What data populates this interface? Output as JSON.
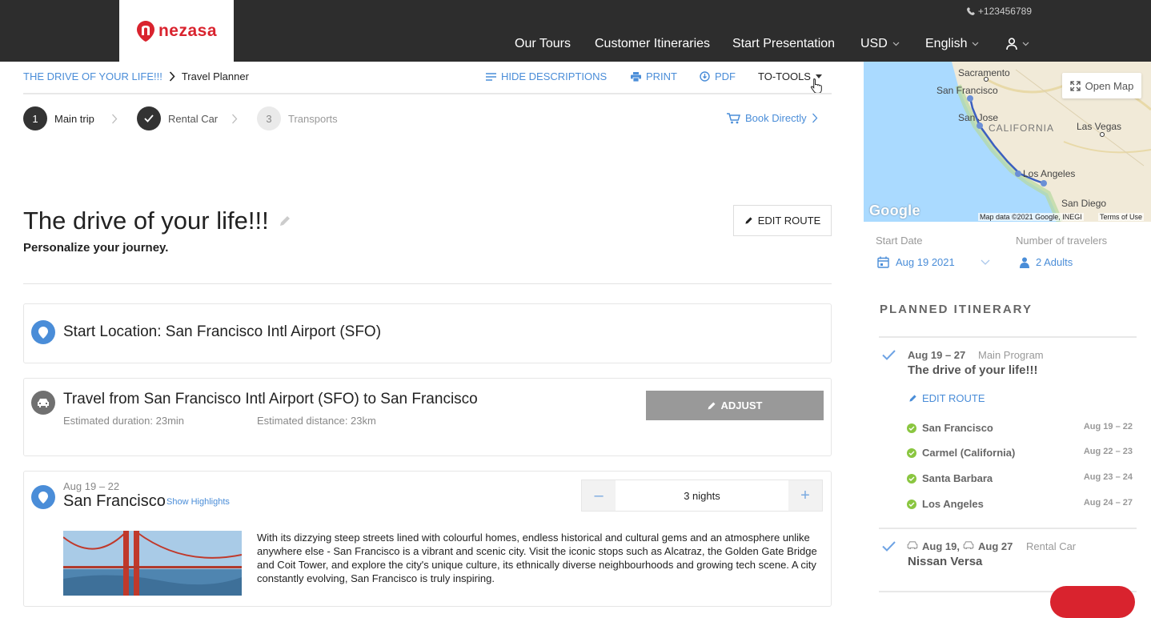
{
  "header": {
    "logo_text": "nezasa",
    "phone": "+123456789",
    "nav": {
      "our_tours": "Our Tours",
      "customer_itineraries": "Customer Itineraries",
      "start_presentation": "Start Presentation",
      "currency": "USD",
      "language": "English"
    }
  },
  "breadcrumb": {
    "root": "THE DRIVE OF YOUR LIFE!!!",
    "current": "Travel Planner"
  },
  "toolbar": {
    "hide_descriptions": "HIDE DESCRIPTIONS",
    "print": "PRINT",
    "pdf": "PDF",
    "to_tools": "TO-TOOLS"
  },
  "steps": [
    {
      "num": "1",
      "label": "Main trip"
    },
    {
      "num": "",
      "label": "Rental Car"
    },
    {
      "num": "3",
      "label": "Transports"
    }
  ],
  "book_directly": "Book Directly",
  "trip": {
    "title": "The drive of your life!!!",
    "subtitle": "Personalize your journey.",
    "edit_route": "EDIT ROUTE"
  },
  "start_card": {
    "title": "Start Location: San Francisco Intl Airport (SFO)"
  },
  "travel_card": {
    "title": "Travel from San Francisco Intl Airport (SFO) to San Francisco",
    "duration": "Estimated duration: 23min",
    "distance": "Estimated distance: 23km",
    "adjust": "ADJUST"
  },
  "stay_card": {
    "dates": "Aug 19 – 22",
    "city": "San Francisco",
    "highlights": "Show Highlights",
    "nights": "3 nights",
    "minus": "–",
    "plus": "+",
    "description": "With its dizzying steep streets lined with colourful homes, endless historical and cultural gems and an atmosphere unlike anywhere else - San Francisco is a vibrant and scenic city. Visit the iconic stops such as Alcatraz, the Golden Gate Bridge and Coit Tower, and explore the city's unique culture, its ethnically diverse neighbourhoods and growing tech scene. A city constantly evolving, San Francisco is truly inspiring."
  },
  "map": {
    "open_map": "Open Map",
    "labels": {
      "sacramento": "Sacramento",
      "san_francisco": "San Francisco",
      "san_jose": "San Jose",
      "california": "CALIFORNIA",
      "las_vegas": "Las Vegas",
      "los_angeles": "Los Angeles",
      "san_diego": "San Diego"
    },
    "google": "Google",
    "attribution": "Map data ©2021 Google, INEGI",
    "terms": "Terms of Use"
  },
  "sidebar": {
    "start_date_label": "Start Date",
    "start_date": "Aug 19 2021",
    "travelers_label": "Number of travelers",
    "travelers": "2 Adults",
    "planned_title": "PLANNED ITINERARY",
    "main": {
      "dates": "Aug 19 – 27",
      "type": "Main Program",
      "title": "The drive of your life!!!",
      "edit": "EDIT ROUTE"
    },
    "stops": [
      {
        "name": "San Francisco",
        "dates": "Aug 19 – 22"
      },
      {
        "name": "Carmel (California)",
        "dates": "Aug 22 – 23"
      },
      {
        "name": "Santa Barbara",
        "dates": "Aug 23 – 24"
      },
      {
        "name": "Los Angeles",
        "dates": "Aug 24 – 27"
      }
    ],
    "rental": {
      "pickup": "Aug 19,",
      "dropoff": "Aug 27",
      "type": "Rental Car",
      "title": "Nissan Versa"
    }
  },
  "colors": {
    "accent": "#4a8dd8",
    "brand": "#d9232e",
    "topbar": "#2d2d2d",
    "success": "#8ac640"
  }
}
